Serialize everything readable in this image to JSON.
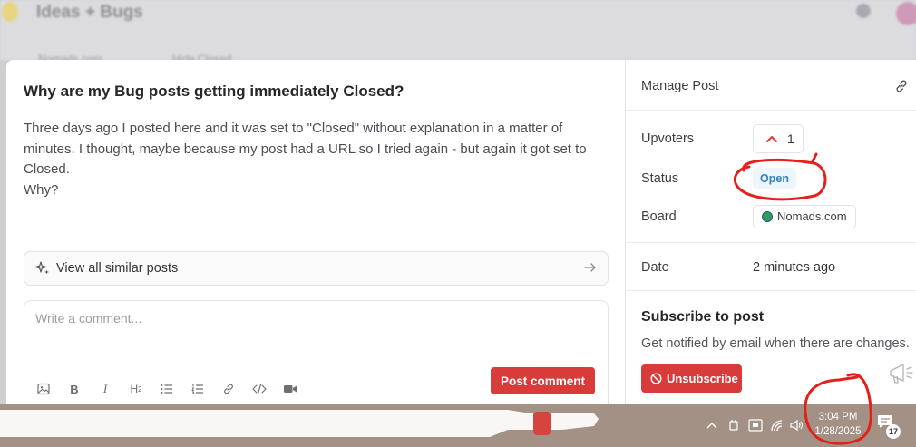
{
  "background": {
    "app_title": "Ideas + Bugs",
    "sub_left": "Nomads.com",
    "sub_right": "Hide Closed"
  },
  "post": {
    "title": "Why are my Bug posts getting immediately Closed?",
    "body_lines": [
      "Three days ago I posted here and it was set to \"Closed\" without explanation in a matter of minutes. I thought, maybe because my post had a URL so I tried again - but again it got set to Closed.",
      "Why?"
    ]
  },
  "similar": {
    "label": "View all similar posts",
    "icon": "sparkle-icon"
  },
  "comment": {
    "placeholder": "Write a comment...",
    "value": "",
    "toolbar": [
      "image-icon",
      "bold-icon",
      "italic-icon",
      "heading-icon",
      "bullet-list-icon",
      "numbered-list-icon",
      "link-icon",
      "code-icon",
      "video-icon"
    ],
    "submit_label": "Post comment"
  },
  "sidebar": {
    "manage_label": "Manage Post",
    "upvoters_label": "Upvoters",
    "upvotes": "1",
    "status_label": "Status",
    "status_value": "Open",
    "board_label": "Board",
    "board_value": "Nomads.com",
    "date_label": "Date",
    "date_value": "2 minutes ago",
    "subscribe_title": "Subscribe to post",
    "subscribe_desc": "Get notified by email when there are changes.",
    "unsubscribe_label": "Unsubscribe"
  },
  "taskbar": {
    "time": "3:04 PM",
    "date": "1/28/2025",
    "notification_count": "17"
  },
  "colors": {
    "accent_red": "#d93a3a",
    "status_blue": "#2d82c5",
    "taskbar": "#a39186"
  }
}
